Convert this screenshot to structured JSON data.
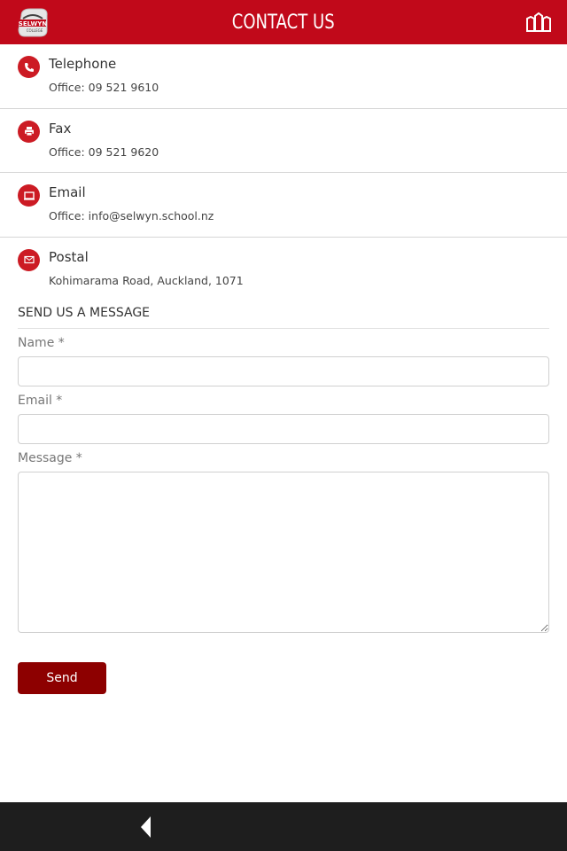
{
  "header": {
    "title": "CONTACT US",
    "logo_text": "SELWYN",
    "logo_subtext": "COLLEGE",
    "left_icon": "school-logo",
    "right_icon": "campus-buildings-icon"
  },
  "contacts": [
    {
      "icon": "phone-icon",
      "label": "Telephone",
      "value": "Office: 09 521 9610"
    },
    {
      "icon": "printer-icon",
      "label": "Fax",
      "value": "Office: 09 521 9620"
    },
    {
      "icon": "laptop-icon",
      "label": "Email",
      "value": "Office: info@selwyn.school.nz"
    },
    {
      "icon": "envelope-icon",
      "label": "Postal",
      "value": "Kohimarama Road, Auckland, 1071"
    }
  ],
  "form": {
    "heading": "SEND US A MESSAGE",
    "name_label": "Name *",
    "name_value": "",
    "email_label": "Email *",
    "email_value": "",
    "message_label": "Message *",
    "message_value": "",
    "send_label": "Send"
  },
  "nav": {
    "back_icon": "back-triangle-icon"
  },
  "colors": {
    "brand_red": "#c1091a",
    "icon_red": "#cc1b24",
    "button_red": "#8d0000",
    "nav_dark": "#1e1e1e"
  }
}
